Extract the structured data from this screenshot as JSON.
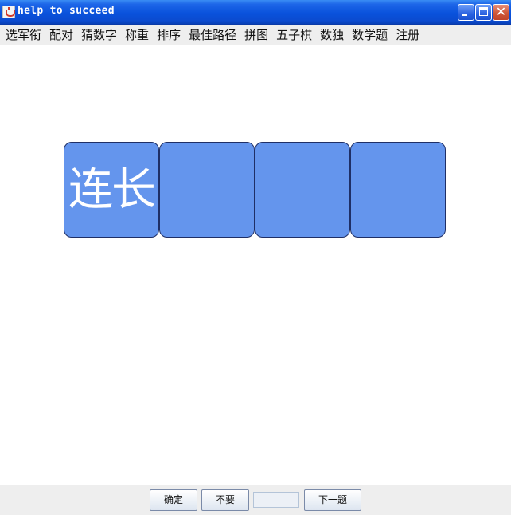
{
  "window": {
    "title": "help to succeed"
  },
  "menu": {
    "items": [
      "选军衔",
      "配对",
      "猜数字",
      "称重",
      "排序",
      "最佳路径",
      "拼图",
      "五子棋",
      "数独",
      "数学题",
      "注册"
    ]
  },
  "tiles": [
    "连长",
    "",
    "",
    ""
  ],
  "bottom": {
    "confirm_label": "确定",
    "skip_label": "不要",
    "answer_value": "",
    "next_label": "下一题"
  }
}
